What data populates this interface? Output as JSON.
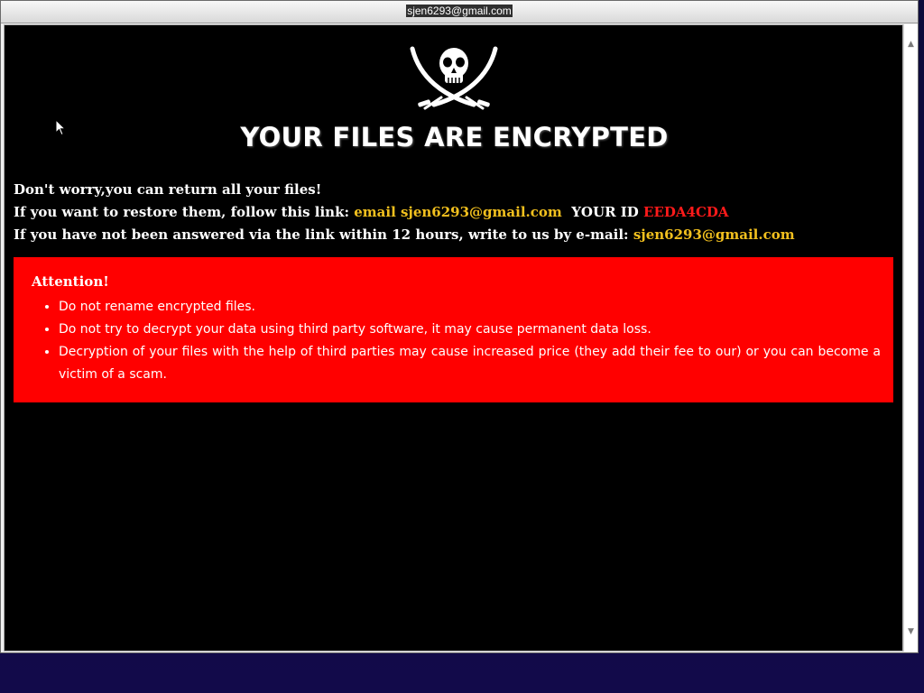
{
  "window": {
    "title": "sjen6293@gmail.com"
  },
  "icons": {
    "logo": "skull-crossed-sabers-icon",
    "cursor": "mouse-pointer-icon",
    "scroll_up": "scroll-up-arrow-icon",
    "scroll_down": "scroll-down-arrow-icon"
  },
  "headline": "YOUR FILES ARE ENCRYPTED",
  "message": {
    "line1": "Don't worry,you can return all your files!",
    "line2_prefix": "If you want to restore them, follow this link: ",
    "line2_link": "email sjen6293@gmail.com",
    "line2_id_label": "YOUR ID ",
    "line2_id_value": "EEDA4CDA",
    "line3_prefix": "If you have not been answered via the link within 12 hours, write to us by e-mail: ",
    "line3_email": "sjen6293@gmail.com"
  },
  "attention": {
    "title": "Attention!",
    "items": [
      "Do not rename encrypted files.",
      "Do not try to decrypt your data using third party software, it may cause permanent data loss.",
      "Decryption of your files with the help of third parties may cause increased price (they add their fee to our) or you can become a victim of a scam."
    ]
  },
  "colors": {
    "background": "#000000",
    "accent_yellow": "#f2c01e",
    "id_red": "#ff1a1a",
    "attention_bg": "#ff0000"
  }
}
